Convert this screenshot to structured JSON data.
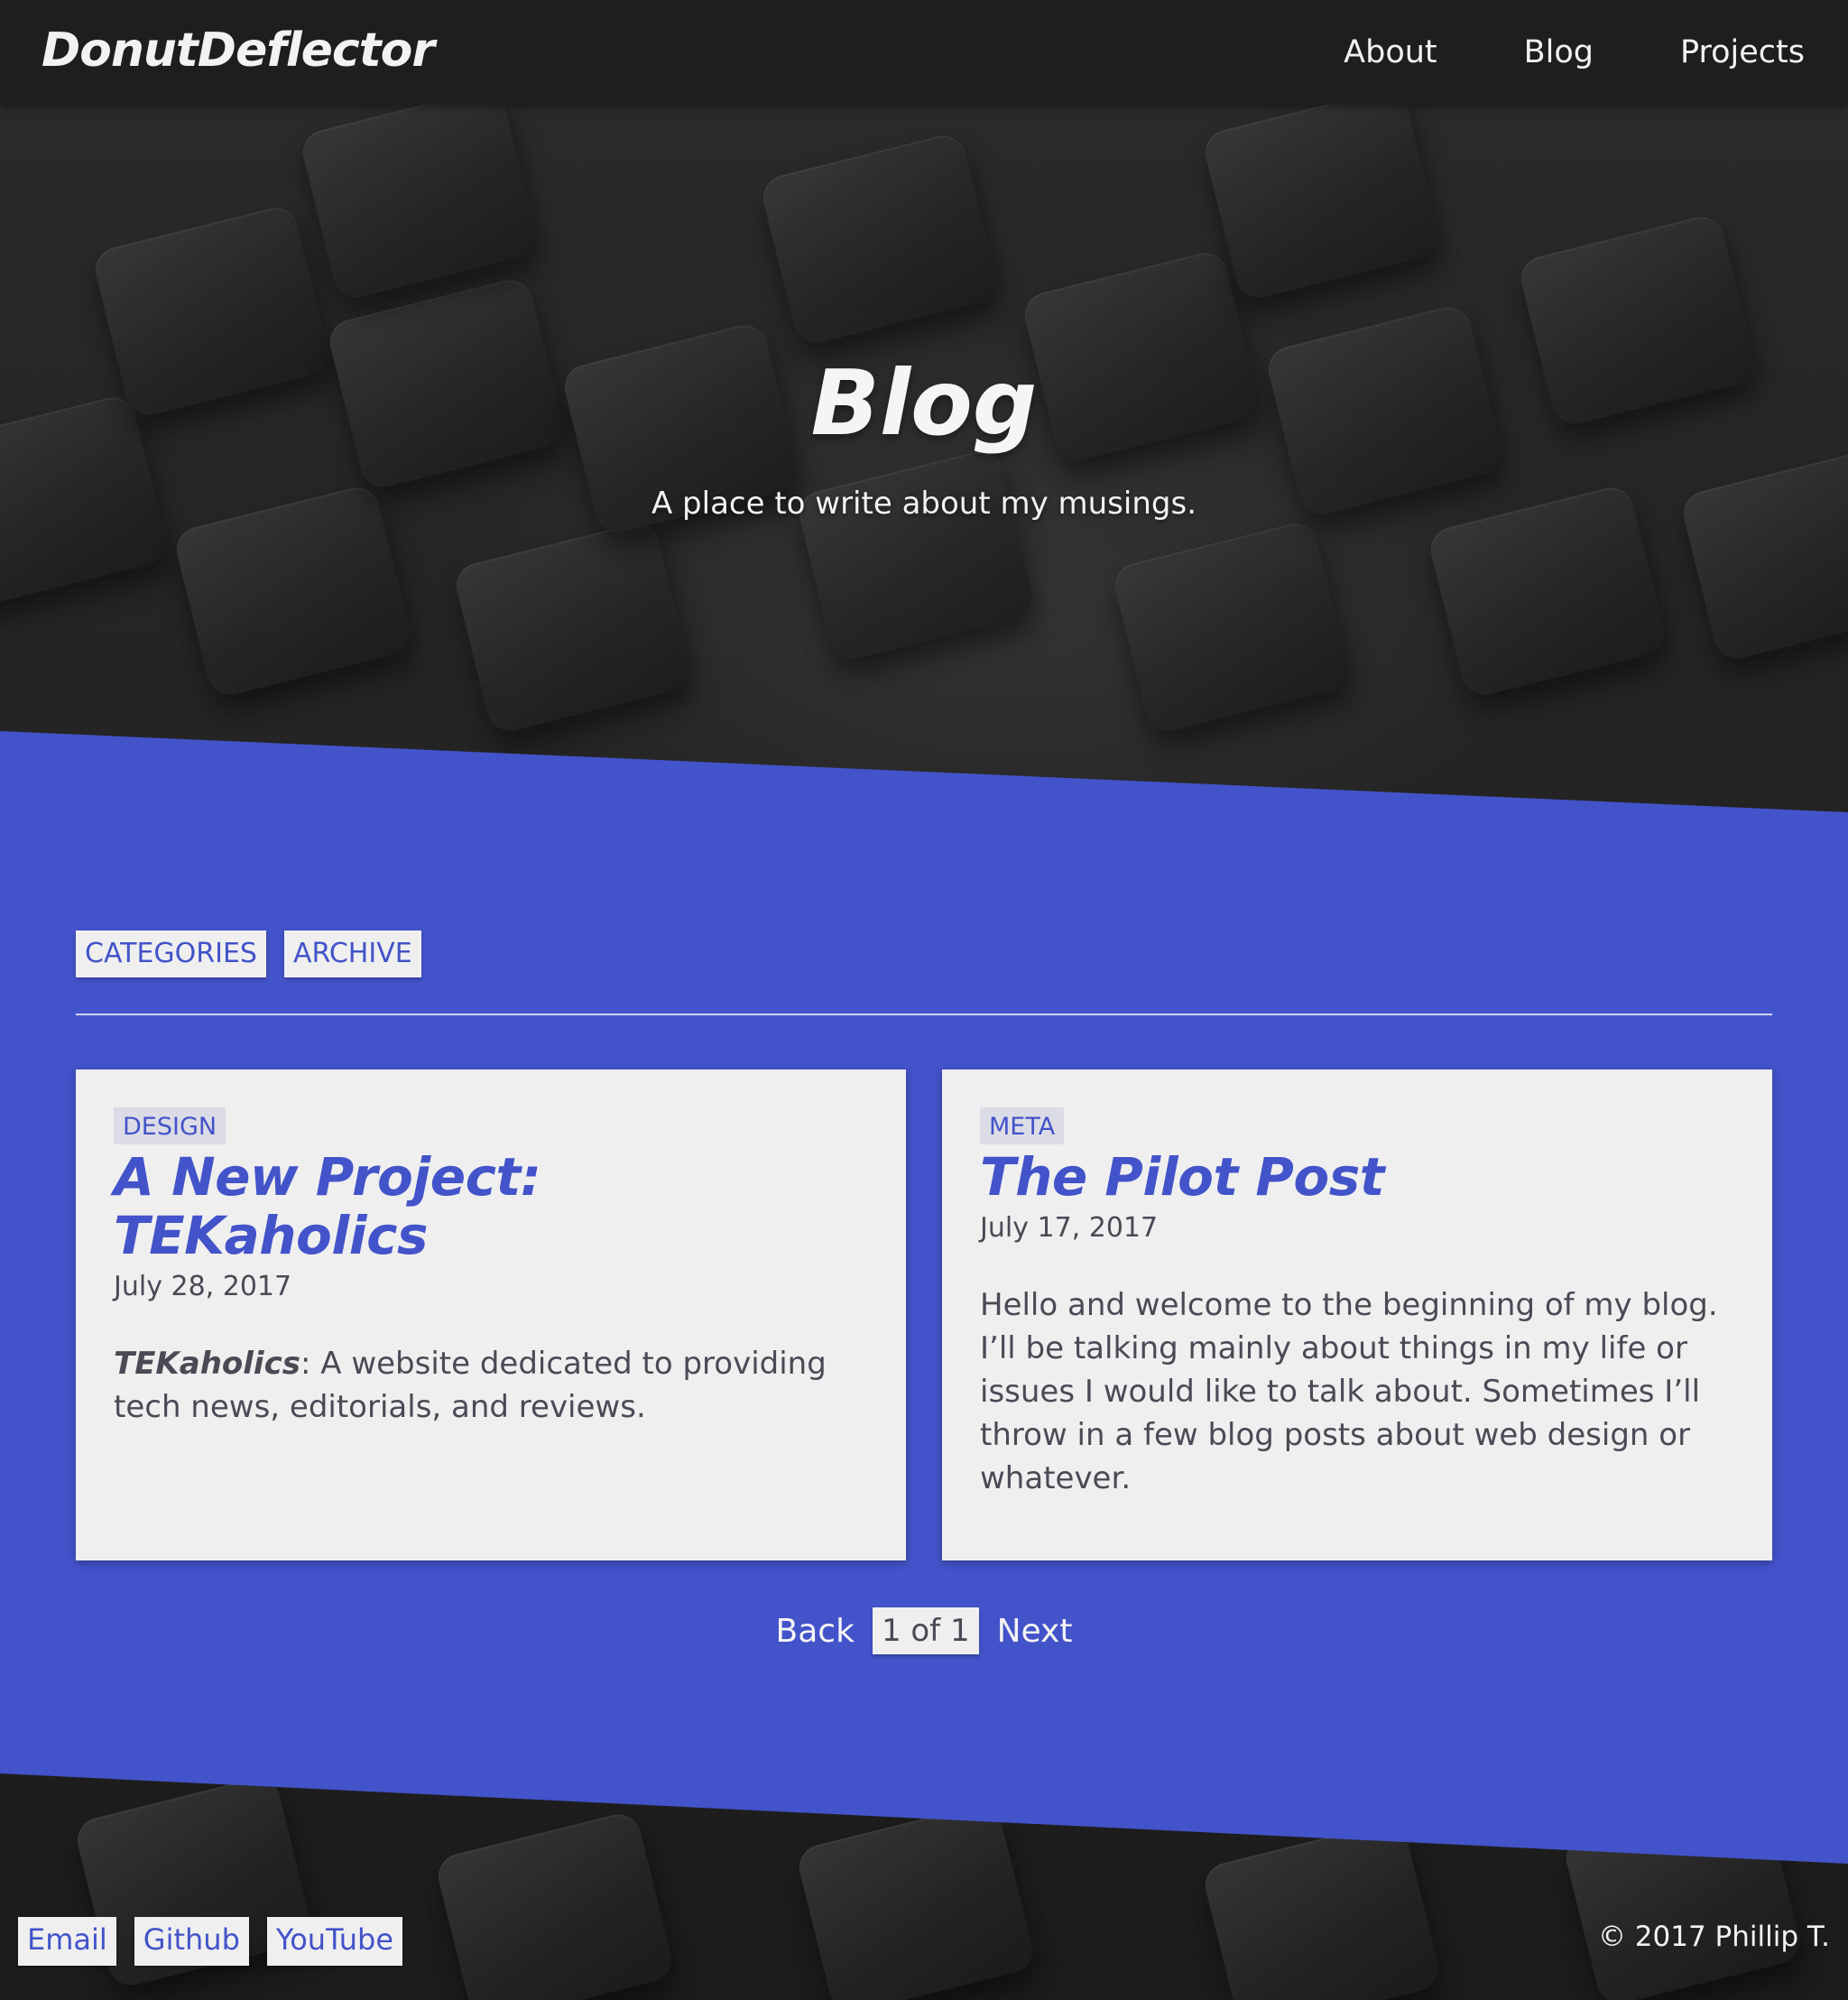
{
  "nav": {
    "brand": "DonutDeflector",
    "links": [
      {
        "label": "About"
      },
      {
        "label": "Blog"
      },
      {
        "label": "Projects"
      }
    ]
  },
  "hero": {
    "title": "Blog",
    "subtitle": "A place to write about my musings."
  },
  "filters": {
    "categories_label": "CATEGORIES",
    "archive_label": "ARCHIVE"
  },
  "posts": [
    {
      "tag": "DESIGN",
      "title": "A New Project: TEKaholics",
      "date": "July 28, 2017",
      "excerpt_bold": "TEKaholics",
      "excerpt": ": A website dedicated to providing tech news, editorials, and reviews."
    },
    {
      "tag": "META",
      "title": "The Pilot Post",
      "date": "July 17, 2017",
      "excerpt": "Hello and welcome to the beginning of my blog. I’ll be talking mainly about things in my life or issues I would like to talk about. Sometimes I’ll throw in a few blog posts about web design or whatever."
    }
  ],
  "pager": {
    "back_label": "Back",
    "current": "1 of 1",
    "next_label": "Next"
  },
  "footer": {
    "links": [
      {
        "label": "Email"
      },
      {
        "label": "Github"
      },
      {
        "label": "YouTube"
      }
    ],
    "copyright": "© 2017 Phillip T."
  },
  "colors": {
    "accent": "#4353c9",
    "navbar": "#1e1e1f",
    "card": "#efefef"
  }
}
